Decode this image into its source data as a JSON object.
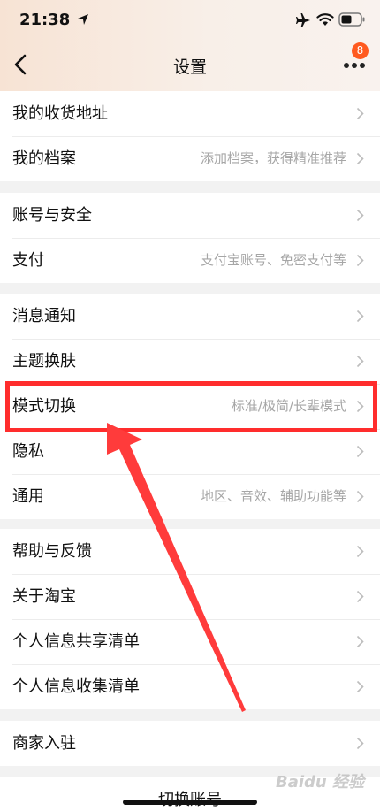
{
  "status_bar": {
    "time": "21:38"
  },
  "nav": {
    "title": "设置",
    "badge_count": "8"
  },
  "groups": [
    {
      "items": [
        {
          "label": "我的收货地址",
          "hint": ""
        },
        {
          "label": "我的档案",
          "hint": "添加档案，获得精准推荐"
        }
      ]
    },
    {
      "items": [
        {
          "label": "账号与安全",
          "hint": ""
        },
        {
          "label": "支付",
          "hint": "支付宝账号、免密支付等"
        }
      ]
    },
    {
      "items": [
        {
          "label": "消息通知",
          "hint": ""
        },
        {
          "label": "主题换肤",
          "hint": ""
        },
        {
          "label": "模式切换",
          "hint": "标准/极简/长辈模式"
        },
        {
          "label": "隐私",
          "hint": ""
        },
        {
          "label": "通用",
          "hint": "地区、音效、辅助功能等"
        }
      ]
    },
    {
      "items": [
        {
          "label": "帮助与反馈",
          "hint": ""
        },
        {
          "label": "关于淘宝",
          "hint": ""
        },
        {
          "label": "个人信息共享清单",
          "hint": ""
        },
        {
          "label": "个人信息收集清单",
          "hint": ""
        }
      ]
    },
    {
      "items": [
        {
          "label": "商家入驻",
          "hint": ""
        }
      ]
    }
  ],
  "footer": {
    "switch_account": "切换账号",
    "watermark": "Baidu 经验"
  },
  "colors": {
    "highlight": "#ff2d2d",
    "badge": "#ff5a1f"
  }
}
